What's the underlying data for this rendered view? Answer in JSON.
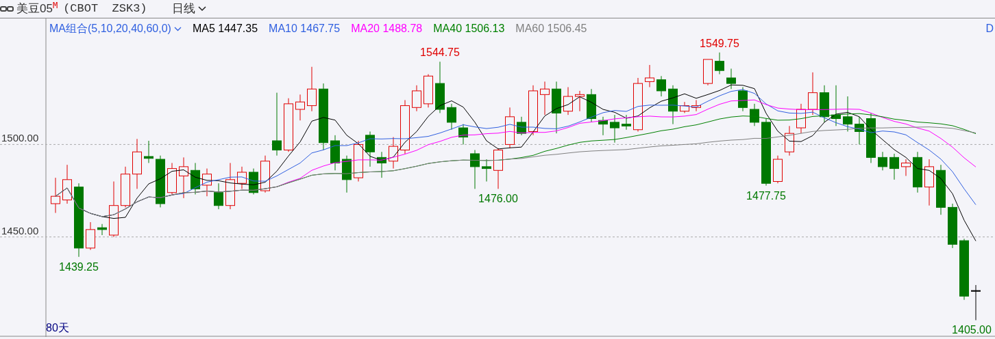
{
  "header": {
    "title": "美豆05",
    "superscript": "M",
    "symbol": "(CBOT  ZSK3)",
    "period": "日线"
  },
  "legend": {
    "combo": "MA组合(5,10,20,40,60,0)",
    "edge_text": "D",
    "items": [
      {
        "label": "MA5",
        "value": "1447.35",
        "color": "#000000"
      },
      {
        "label": "MA10",
        "value": "1467.75",
        "color": "#3060e0"
      },
      {
        "label": "MA20",
        "value": "1488.78",
        "color": "#ff00ff"
      },
      {
        "label": "MA40",
        "value": "1506.13",
        "color": "#008000"
      },
      {
        "label": "MA60",
        "value": "1506.45",
        "color": "#808080"
      }
    ]
  },
  "chart": {
    "footer": "80天",
    "y_axis_labels": [
      "1500.00",
      "1450.00"
    ],
    "price_labels": [
      {
        "text": "1439.25",
        "kind": "low"
      },
      {
        "text": "1544.75",
        "kind": "high"
      },
      {
        "text": "1476.00",
        "kind": "low"
      },
      {
        "text": "1549.75",
        "kind": "high"
      },
      {
        "text": "1477.75",
        "kind": "low"
      },
      {
        "text": "1405.00",
        "kind": "low"
      }
    ]
  }
}
